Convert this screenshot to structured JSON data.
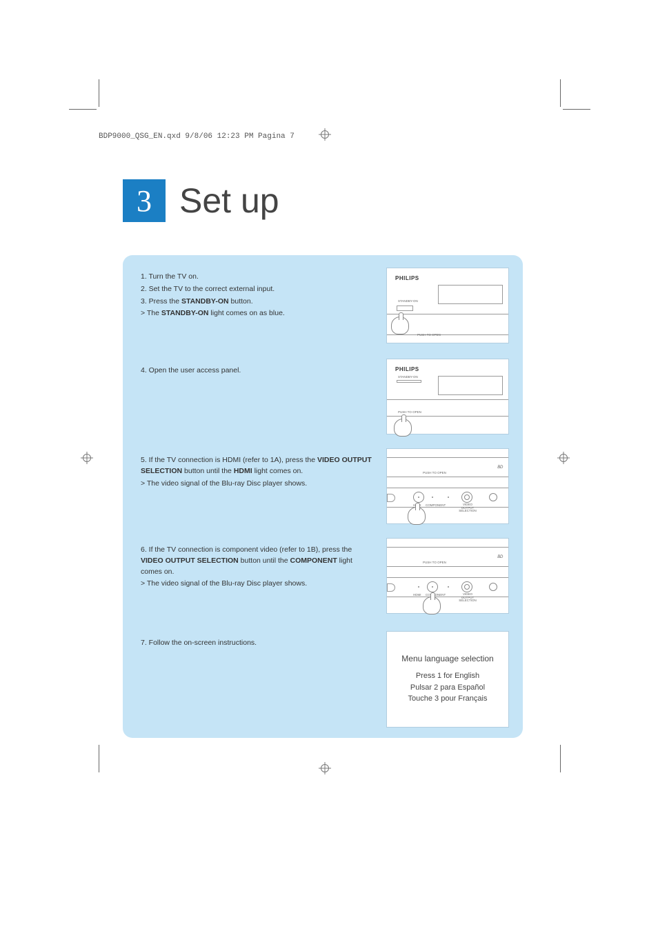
{
  "header": "BDP9000_QSG_EN.qxd  9/8/06  12:23 PM  Pagina 7",
  "section_number": "3",
  "section_title": "Set up",
  "steps": {
    "s1": "1. Turn the TV on.",
    "s2": "2. Set the TV to the correct external input.",
    "s3_pre": "3. Press the ",
    "s3_bold": "STANDBY-ON",
    "s3_post": " button.",
    "s3_note_pre": "> The ",
    "s3_note_bold": "STANDBY-ON",
    "s3_note_post": " light comes on as blue.",
    "s4": "4. Open the user access panel.",
    "s5_pre": "5. If the TV connection is HDMI (refer to 1A), press the ",
    "s5_bold1": "VIDEO OUTPUT SELECTION",
    "s5_mid": " button until the ",
    "s5_bold2": "HDMI",
    "s5_post": " light comes on.",
    "s5_note": "> The video signal of the Blu-ray Disc player shows.",
    "s6_pre": "6. If the TV connection is component video (refer to 1B), press the ",
    "s6_bold1": "VIDEO OUTPUT SELECTION",
    "s6_mid": " button until the ",
    "s6_bold2": "COMPONENT",
    "s6_post": " light comes on.",
    "s6_note": "> The video signal of the Blu-ray Disc player shows.",
    "s7": "7. Follow the on-screen instructions."
  },
  "illus": {
    "brand": "PHILIPS",
    "standby_label": "STANDBY-ON",
    "push_open": "PUSH TO OPEN",
    "bd_logo": "BD",
    "hdmi": "HDMI",
    "component": "COMPONENT",
    "video_out": "VIDEO OUTPUT SELECTION"
  },
  "menu_screen": {
    "title": "Menu language selection",
    "opt1": "Press 1 for English",
    "opt2": "Pulsar 2 para Español",
    "opt3": "Touche 3 pour Français"
  }
}
